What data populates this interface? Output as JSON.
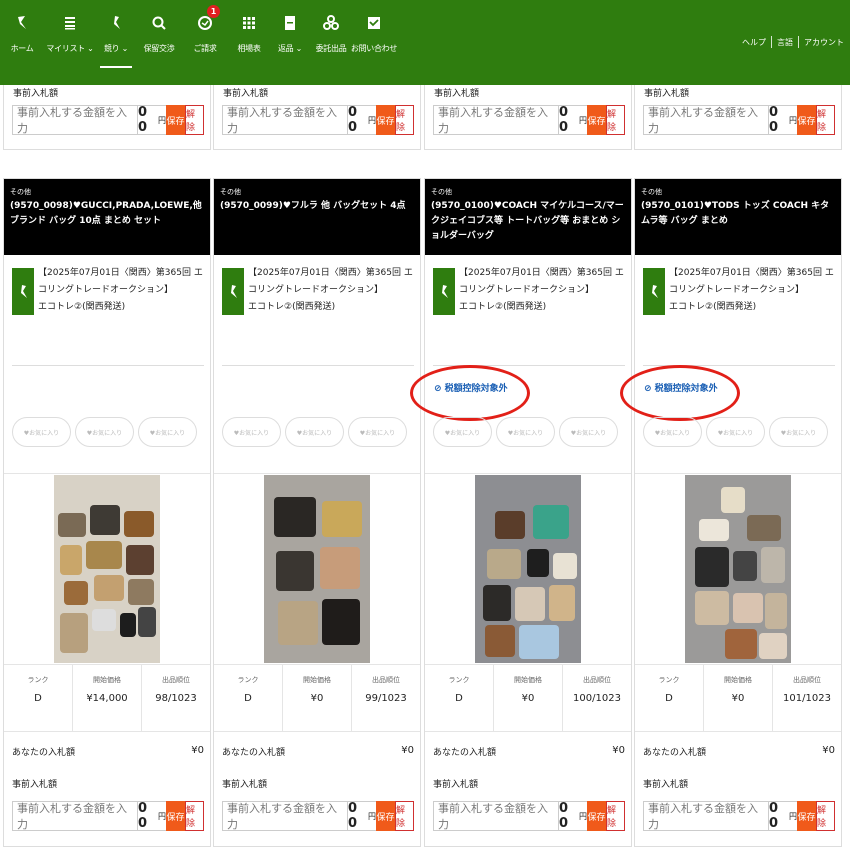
{
  "nav": {
    "items": [
      {
        "label": "ホーム",
        "icon": "leaf-logo-icon"
      },
      {
        "label": "マイリスト ⌄",
        "icon": "list-icon"
      },
      {
        "label": "競り ⌄",
        "icon": "gavel-icon"
      },
      {
        "label": "保留交渉",
        "icon": "chat-icon"
      },
      {
        "label": "ご請求",
        "icon": "billing-icon",
        "badge": "1"
      },
      {
        "label": "相場表",
        "icon": "grid-icon"
      },
      {
        "label": "返品 ⌄",
        "icon": "document-icon"
      },
      {
        "label": "委託出品",
        "icon": "consign-icon"
      },
      {
        "label": "お問い合わせ",
        "icon": "mail-icon"
      }
    ],
    "right": [
      "ヘルプ",
      "言語",
      "アカウント"
    ]
  },
  "bid_form": {
    "label": "事前入札額",
    "placeholder": "事前入札する金額を入力",
    "zero": "0 0",
    "yen": "円",
    "save": "保存",
    "cancel": "解除"
  },
  "fav_label": "♥お気に入り",
  "your_bid_label": "あなたの入札額",
  "stat_labels": {
    "rank": "ランク",
    "start": "開始価格",
    "order": "出品順位"
  },
  "cards": [
    {
      "category": "その他",
      "title": "(9570_0098)♥GUCCI,PRADA,LOEWE,他ブランド バッグ 10点 まとめ セット",
      "auction": "【2025年07月01日〈関西〉第365回 エコリングトレードオークション】",
      "venue": "エコトレ②(関西発送)",
      "tax_note": "",
      "rank": "D",
      "start_price": "¥14,000",
      "order": "98/1023",
      "your_bid": "¥0"
    },
    {
      "category": "その他",
      "title": "(9570_0099)♥フルラ 他 バッグセット 4点",
      "auction": "【2025年07月01日〈関西〉第365回 エコリングトレードオークション】",
      "venue": "エコトレ②(関西発送)",
      "tax_note": "",
      "rank": "D",
      "start_price": "¥0",
      "order": "99/1023",
      "your_bid": "¥0"
    },
    {
      "category": "その他",
      "title": "(9570_0100)♥COACH マイケルコース/マークジェイコブス等 トートバッグ等 おまとめ ショルダーバッグ",
      "auction": "【2025年07月01日〈関西〉第365回 エコリングトレードオークション】",
      "venue": "エコトレ②(関西発送)",
      "tax_note": "⊘ 税額控除対象外",
      "rank": "D",
      "start_price": "¥0",
      "order": "100/1023",
      "your_bid": "¥0"
    },
    {
      "category": "その他",
      "title": "(9570_0101)♥TODS トッズ COACH キタムラ等 バッグ まとめ",
      "auction": "【2025年07月01日〈関西〉第365回 エコリングトレードオークション】",
      "venue": "エコトレ②(関西発送)",
      "tax_note": "⊘ 税額控除対象外",
      "rank": "D",
      "start_price": "¥0",
      "order": "101/1023",
      "your_bid": "¥0"
    }
  ]
}
